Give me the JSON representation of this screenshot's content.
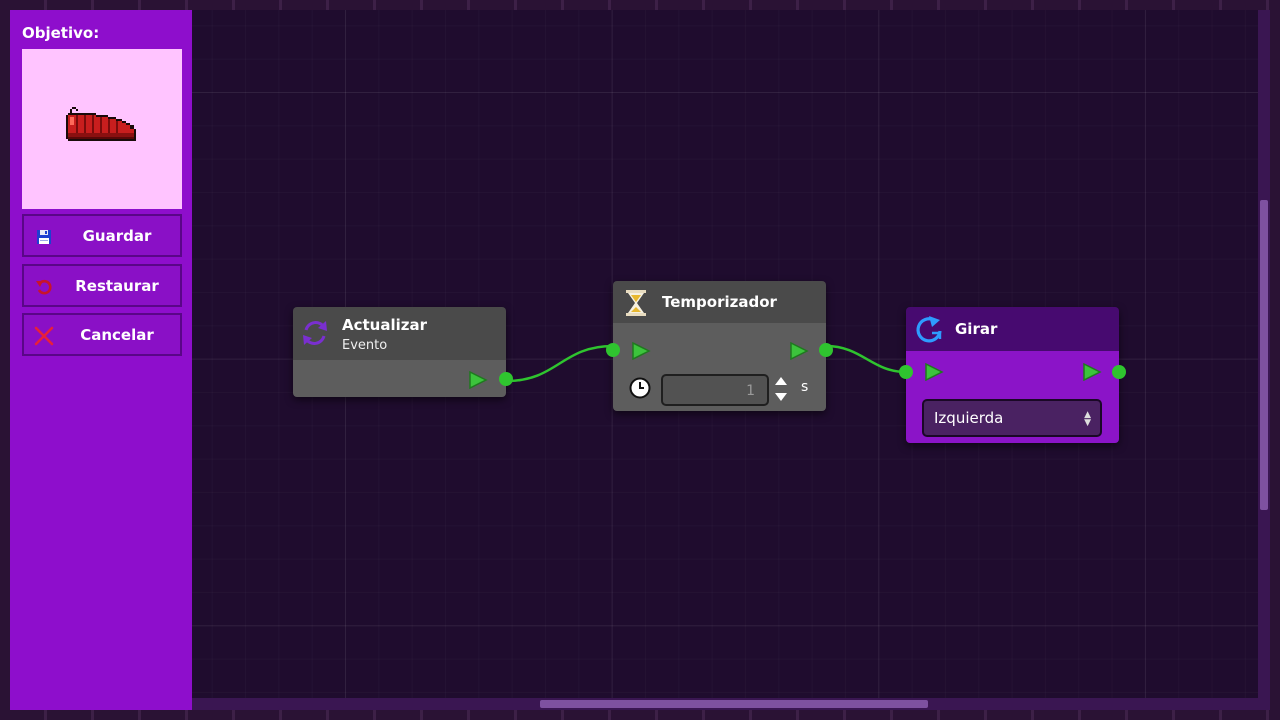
{
  "sidebar": {
    "title": "Objetivo:",
    "buttons": {
      "save": "Guardar",
      "restore": "Restaurar",
      "cancel": "Cancelar"
    }
  },
  "nodes": {
    "update": {
      "title": "Actualizar",
      "subtitle": "Evento"
    },
    "timer": {
      "title": "Temporizador",
      "value": "1",
      "unit": "s"
    },
    "rotate": {
      "title": "Girar",
      "direction": "Izquierda"
    }
  },
  "colors": {
    "sidebar": "#8e0ecc",
    "objective_bg": "#ffc4ff",
    "canvas": "#1f0c2e",
    "port": "#2fc42f",
    "wire": "#2fc42f"
  },
  "icons": {
    "objective": "red-slug-sprite",
    "save": "floppy-disk-icon",
    "restore": "undo-arrow-icon",
    "cancel": "x-icon",
    "update": "refresh-cycle-icon",
    "timer": "hourglass-icon",
    "timer_field": "clock-icon",
    "rotate": "rotate-arrow-icon"
  }
}
